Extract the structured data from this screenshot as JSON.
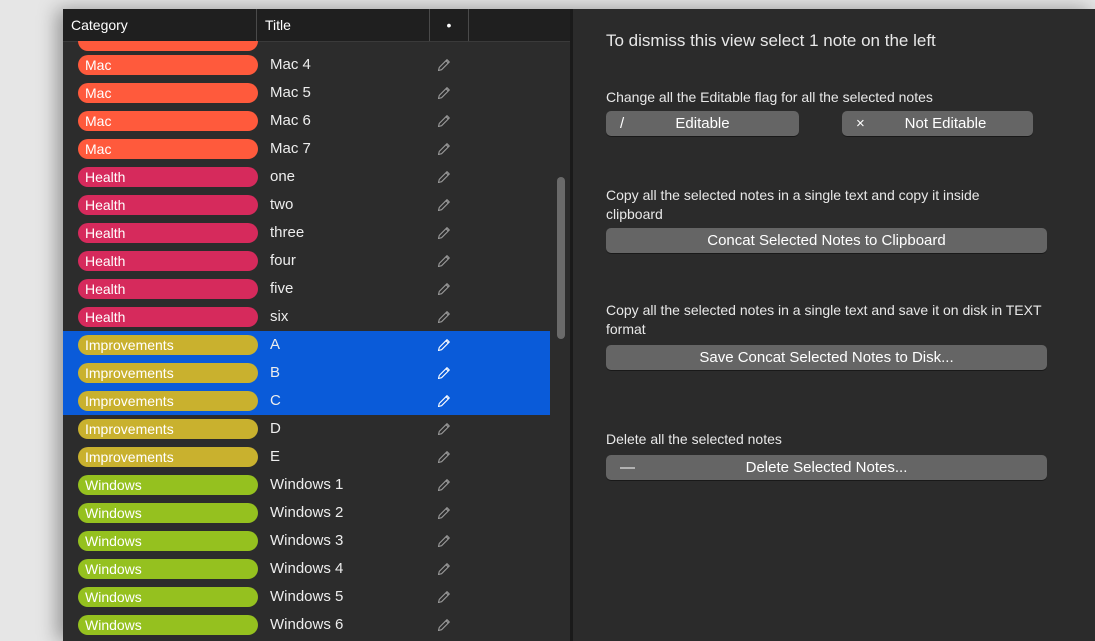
{
  "table": {
    "headers": {
      "category": "Category",
      "title": "Title",
      "dot": "•"
    },
    "rows": [
      {
        "category": "Mac",
        "title": "Mac 4",
        "color": "#ff5a3c",
        "selected": false
      },
      {
        "category": "Mac",
        "title": "Mac 5",
        "color": "#ff5a3c",
        "selected": false
      },
      {
        "category": "Mac",
        "title": "Mac 6",
        "color": "#ff5a3c",
        "selected": false
      },
      {
        "category": "Mac",
        "title": "Mac 7",
        "color": "#ff5a3c",
        "selected": false
      },
      {
        "category": "Health",
        "title": "one",
        "color": "#d62a5c",
        "selected": false
      },
      {
        "category": "Health",
        "title": "two",
        "color": "#d62a5c",
        "selected": false
      },
      {
        "category": "Health",
        "title": "three",
        "color": "#d62a5c",
        "selected": false
      },
      {
        "category": "Health",
        "title": "four",
        "color": "#d62a5c",
        "selected": false
      },
      {
        "category": "Health",
        "title": "five",
        "color": "#d62a5c",
        "selected": false
      },
      {
        "category": "Health",
        "title": "six",
        "color": "#d62a5c",
        "selected": false
      },
      {
        "category": "Improvements",
        "title": "A",
        "color": "#c9b12e",
        "selected": true
      },
      {
        "category": "Improvements",
        "title": "B",
        "color": "#c9b12e",
        "selected": true
      },
      {
        "category": "Improvements",
        "title": "C",
        "color": "#c9b12e",
        "selected": true
      },
      {
        "category": "Improvements",
        "title": "D",
        "color": "#c9b12e",
        "selected": false
      },
      {
        "category": "Improvements",
        "title": "E",
        "color": "#c9b12e",
        "selected": false
      },
      {
        "category": "Windows",
        "title": "Windows 1",
        "color": "#95c11f",
        "selected": false
      },
      {
        "category": "Windows",
        "title": "Windows 2",
        "color": "#95c11f",
        "selected": false
      },
      {
        "category": "Windows",
        "title": "Windows 3",
        "color": "#95c11f",
        "selected": false
      },
      {
        "category": "Windows",
        "title": "Windows 4",
        "color": "#95c11f",
        "selected": false
      },
      {
        "category": "Windows",
        "title": "Windows 5",
        "color": "#95c11f",
        "selected": false
      },
      {
        "category": "Windows",
        "title": "Windows 6",
        "color": "#95c11f",
        "selected": false
      }
    ]
  },
  "panel": {
    "dismiss_text": "To dismiss this view select 1 note on the left",
    "editable_desc": "Change all the Editable flag for all the selected notes",
    "editable_label": "Editable",
    "editable_icon": "/",
    "not_editable_label": "Not Editable",
    "not_editable_icon": "×",
    "clipboard_desc": "Copy all the selected notes in a single text and copy it inside clipboard",
    "clipboard_label": "Concat Selected Notes to Clipboard",
    "disk_desc": "Copy all the selected notes in a single text and save it on disk in TEXT format",
    "disk_label": "Save Concat Selected Notes to Disk...",
    "delete_desc": "Delete all the selected notes",
    "delete_label": "Delete Selected Notes...",
    "delete_icon": "—"
  }
}
